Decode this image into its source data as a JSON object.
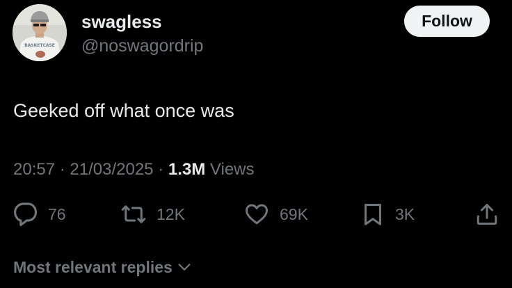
{
  "author": {
    "display_name": "swagless",
    "handle": "@noswagordrip",
    "avatar_shirt_text": "BASKETCASE"
  },
  "follow_label": "Follow",
  "tweet": {
    "text": "Geeked off what once was",
    "time": "20:57",
    "date": "21/03/2025",
    "views_count": "1.3M",
    "views_label": "Views",
    "separator": "·"
  },
  "actions": {
    "replies": "76",
    "reposts": "12K",
    "likes": "69K",
    "bookmarks": "3K"
  },
  "replies_sort_label": "Most relevant replies",
  "colors": {
    "background": "#000000",
    "primary_text": "#e7e9ea",
    "secondary_text": "#71767b",
    "follow_bg": "#eff3f4",
    "follow_text": "#0f1419"
  }
}
